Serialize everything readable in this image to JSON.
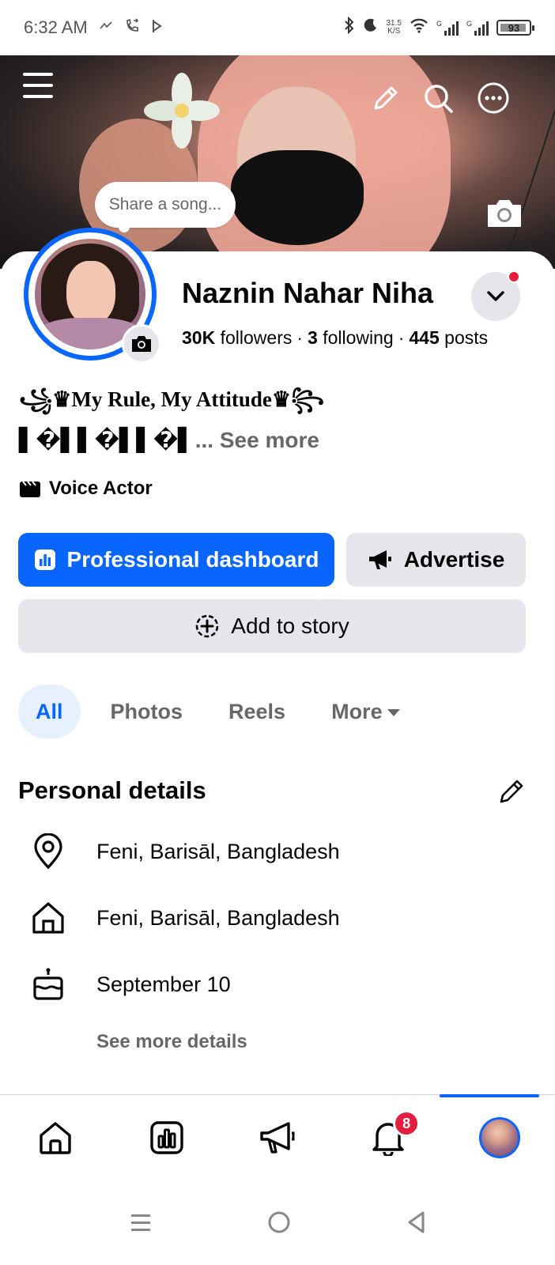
{
  "status_bar": {
    "time": "6:32 AM",
    "net_speed_value": "31.5",
    "net_speed_unit": "K/S",
    "battery": "93",
    "signal_label_1": "G",
    "signal_label_2": "G",
    "icons": [
      "data-saver-icon",
      "call-forward-icon",
      "tag-icon",
      "bluetooth-icon",
      "moon-icon",
      "wifi-icon",
      "signal-icon",
      "signal-icon",
      "battery-icon"
    ]
  },
  "cover": {
    "share_song_placeholder": "Share a song..."
  },
  "profile": {
    "name": "Naznin Nahar Niha",
    "followers_count": "30K",
    "followers_label": "followers",
    "following_count": "3",
    "following_label": "following",
    "posts_count": "445",
    "posts_label": "posts",
    "bio_line1": "꧁♛My Rule, My Attitude♛꧂",
    "bio_line2": "▌�▌▌�▌▌�▌",
    "bio_ellipsis": "...",
    "see_more": "See more",
    "job": "Voice Actor",
    "has_notification_dot": true
  },
  "actions": {
    "professional_dashboard": "Professional dashboard",
    "advertise": "Advertise",
    "add_to_story": "Add to story"
  },
  "tabs": [
    {
      "label": "All",
      "active": true
    },
    {
      "label": "Photos",
      "active": false
    },
    {
      "label": "Reels",
      "active": false
    },
    {
      "label": "More",
      "active": false
    }
  ],
  "personal_details": {
    "title": "Personal details",
    "items": [
      {
        "icon": "location-pin-icon",
        "text": "Feni, Barisāl, Bangladesh"
      },
      {
        "icon": "home-icon",
        "text": "Feni, Barisāl, Bangladesh"
      },
      {
        "icon": "birthday-cake-icon",
        "text": "September 10"
      }
    ],
    "see_more_details": "See more details"
  },
  "bottom_nav": {
    "items": [
      "home-icon",
      "dashboard-icon",
      "megaphone-icon",
      "notifications-icon",
      "profile-avatar"
    ],
    "notification_badge": "8",
    "active_index": 4
  },
  "colors": {
    "accent": "#0866ff",
    "badge": "#e41e3f",
    "secondary_button": "#e4e6eb",
    "secondary_text": "#65676b"
  }
}
